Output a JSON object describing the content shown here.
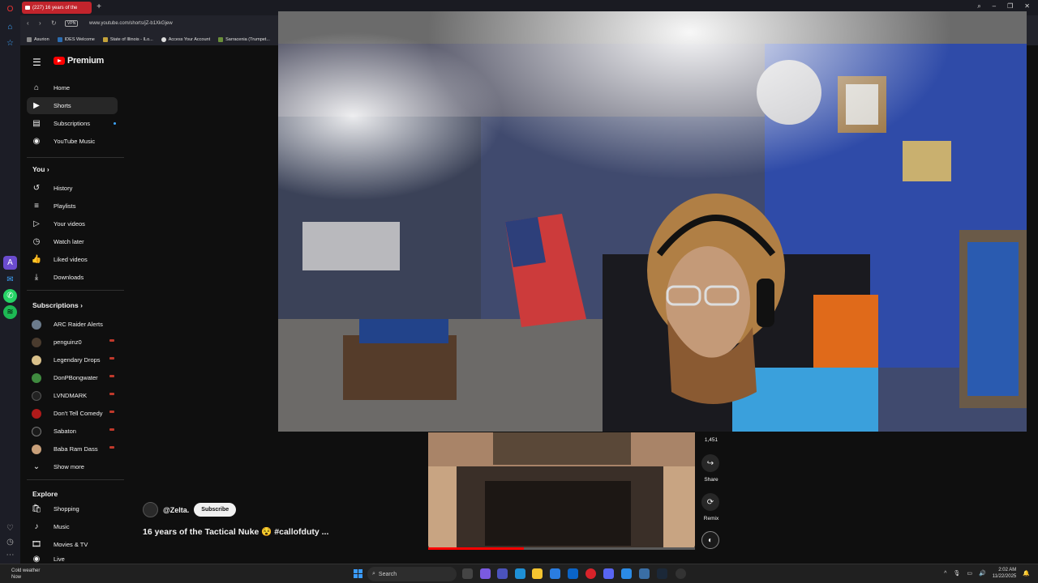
{
  "browser": {
    "tab_title": "(227) 16 years of the",
    "url": "www.youtube.com/shorts/jZ-b1XkGjew",
    "vpn": "VPN",
    "bookmarks": [
      "Asurion",
      "IDES Welcome",
      "State of Illinois - ILo...",
      "Access Your Account",
      "Sarracenia (Trumpet..."
    ]
  },
  "youtube": {
    "brand": "Premium",
    "main_nav": [
      {
        "label": "Home",
        "icon": "home-icon"
      },
      {
        "label": "Shorts",
        "icon": "shorts-icon",
        "active": true
      },
      {
        "label": "Subscriptions",
        "icon": "subscriptions-icon"
      },
      {
        "label": "YouTube Music",
        "icon": "music-icon"
      }
    ],
    "you_heading": "You",
    "you_nav": [
      {
        "label": "History",
        "icon": "history-icon"
      },
      {
        "label": "Playlists",
        "icon": "playlists-icon"
      },
      {
        "label": "Your videos",
        "icon": "your-videos-icon"
      },
      {
        "label": "Watch later",
        "icon": "watch-later-icon"
      },
      {
        "label": "Liked videos",
        "icon": "liked-icon"
      },
      {
        "label": "Downloads",
        "icon": "downloads-icon"
      }
    ],
    "subscriptions_heading": "Subscriptions",
    "subscriptions": [
      {
        "label": "ARC Raider Alerts",
        "color": "#6b7b8c"
      },
      {
        "label": "penguinz0",
        "color": "#4a3b2e"
      },
      {
        "label": "Legendary Drops",
        "color": "#d9c08a"
      },
      {
        "label": "DonPBongwater",
        "color": "#3f8a3f"
      },
      {
        "label": "LVNDMARK",
        "color": "#222222"
      },
      {
        "label": "Don't Tell Comedy",
        "color": "#b01a1a"
      },
      {
        "label": "Sabaton",
        "color": "#1a1a1a"
      },
      {
        "label": "Baba Ram Dass",
        "color": "#c9a07a"
      }
    ],
    "show_more": "Show more",
    "explore_heading": "Explore",
    "explore": [
      {
        "label": "Shopping",
        "icon": "shopping-icon"
      },
      {
        "label": "Music",
        "icon": "music-note-icon"
      },
      {
        "label": "Movies & TV",
        "icon": "movies-icon"
      },
      {
        "label": "Live",
        "icon": "live-icon"
      }
    ],
    "short": {
      "channel": "@Zelta.",
      "subscribe_label": "Subscribe",
      "title": "16 years of the Tactical Nuke 😵 #callofduty ...",
      "like_count": "1,451",
      "share_label": "Share",
      "remix_label": "Remix",
      "progress": 0.36
    }
  },
  "taskbar": {
    "weather_title": "Cold weather",
    "weather_sub": "Now",
    "search_placeholder": "Search",
    "time": "2:02 AM",
    "date": "11/22/2025"
  }
}
